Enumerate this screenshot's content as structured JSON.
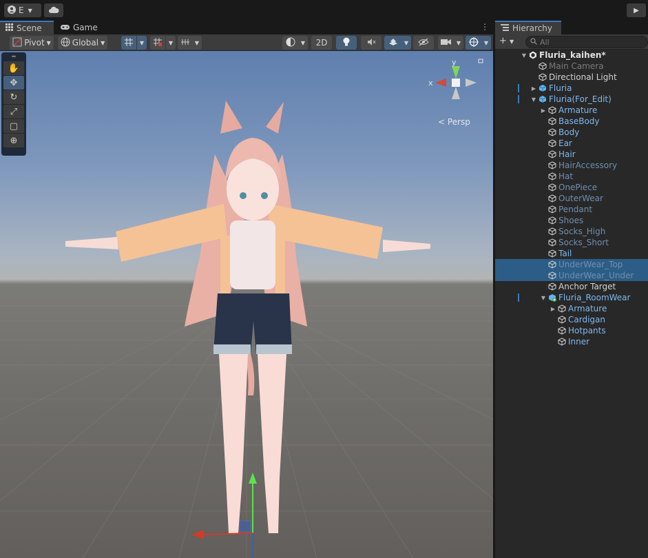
{
  "topbar": {
    "account_label": "E",
    "account_icon": "account-icon",
    "cloud_icon": "cloud-icon",
    "play_icon": "play-icon"
  },
  "scene_tabs": {
    "scene_label": "Scene",
    "game_label": "Game",
    "menu_icon": "kebab-icon"
  },
  "scene_toolbar": {
    "pivot_label": "Pivot",
    "global_label": "Global",
    "mode_2d_label": "2D"
  },
  "tool_palette": [
    "hand-tool",
    "move-tool",
    "rotate-tool",
    "scale-tool",
    "rect-tool",
    "transform-tool"
  ],
  "viewport": {
    "persp_label": "Persp",
    "axis_x_label": "x",
    "axis_y_label": "y"
  },
  "hierarchy": {
    "tab_label": "Hierarchy",
    "add_label": "+",
    "search_placeholder": "All",
    "items": [
      {
        "label": "Fluria_kaihen*",
        "depth": 0,
        "arrow": "down",
        "icon": "unity-scene-icon",
        "style": "bold"
      },
      {
        "label": "Main Camera",
        "depth": 1,
        "arrow": "",
        "icon": "gameobject-icon",
        "style": "grey"
      },
      {
        "label": "Directional Light",
        "depth": 1,
        "arrow": "",
        "icon": "gameobject-icon",
        "style": "normal"
      },
      {
        "label": "Fluria",
        "depth": 1,
        "arrow": "right",
        "icon": "prefab-icon",
        "style": "blue",
        "mark": true
      },
      {
        "label": "Fluria(For_Edit)",
        "depth": 1,
        "arrow": "down",
        "icon": "prefab-icon",
        "style": "blue",
        "mark": true
      },
      {
        "label": "Armature",
        "depth": 2,
        "arrow": "right",
        "icon": "gameobject-icon",
        "style": "blue"
      },
      {
        "label": "BaseBody",
        "depth": 2,
        "arrow": "",
        "icon": "gameobject-icon",
        "style": "blue"
      },
      {
        "label": "Body",
        "depth": 2,
        "arrow": "",
        "icon": "gameobject-icon",
        "style": "blue"
      },
      {
        "label": "Ear",
        "depth": 2,
        "arrow": "",
        "icon": "gameobject-icon",
        "style": "blue"
      },
      {
        "label": "Hair",
        "depth": 2,
        "arrow": "",
        "icon": "gameobject-icon",
        "style": "blue"
      },
      {
        "label": "HairAccessory",
        "depth": 2,
        "arrow": "",
        "icon": "gameobject-icon",
        "style": "dim"
      },
      {
        "label": "Hat",
        "depth": 2,
        "arrow": "",
        "icon": "gameobject-icon",
        "style": "dim"
      },
      {
        "label": "OnePiece",
        "depth": 2,
        "arrow": "",
        "icon": "gameobject-icon",
        "style": "dim"
      },
      {
        "label": "OuterWear",
        "depth": 2,
        "arrow": "",
        "icon": "gameobject-icon",
        "style": "dim"
      },
      {
        "label": "Pendant",
        "depth": 2,
        "arrow": "",
        "icon": "gameobject-icon",
        "style": "dim"
      },
      {
        "label": "Shoes",
        "depth": 2,
        "arrow": "",
        "icon": "gameobject-icon",
        "style": "dim"
      },
      {
        "label": "Socks_High",
        "depth": 2,
        "arrow": "",
        "icon": "gameobject-icon",
        "style": "dim"
      },
      {
        "label": "Socks_Short",
        "depth": 2,
        "arrow": "",
        "icon": "gameobject-icon",
        "style": "dim"
      },
      {
        "label": "Tail",
        "depth": 2,
        "arrow": "",
        "icon": "gameobject-icon",
        "style": "blue"
      },
      {
        "label": "UnderWear_Top",
        "depth": 2,
        "arrow": "",
        "icon": "gameobject-icon",
        "style": "dim",
        "selected": true
      },
      {
        "label": "UnderWear_Under",
        "depth": 2,
        "arrow": "",
        "icon": "gameobject-icon",
        "style": "dim",
        "selected": true
      },
      {
        "label": "Anchor Target",
        "depth": 2,
        "arrow": "",
        "icon": "gameobject-icon",
        "style": "normal"
      },
      {
        "label": "Fluria_RoomWear",
        "depth": 2,
        "arrow": "down",
        "icon": "prefab-added-icon",
        "style": "blue",
        "mark": true
      },
      {
        "label": "Armature",
        "depth": 3,
        "arrow": "right",
        "icon": "gameobject-icon",
        "style": "blue"
      },
      {
        "label": "Cardigan",
        "depth": 3,
        "arrow": "",
        "icon": "gameobject-icon",
        "style": "blue"
      },
      {
        "label": "Hotpants",
        "depth": 3,
        "arrow": "",
        "icon": "gameobject-icon",
        "style": "blue"
      },
      {
        "label": "Inner",
        "depth": 3,
        "arrow": "",
        "icon": "gameobject-icon",
        "style": "blue"
      }
    ]
  },
  "colors": {
    "accent": "#3a79bb",
    "selection": "#2c5d87",
    "panel": "#282828",
    "toolbar": "#3c3c3c"
  }
}
